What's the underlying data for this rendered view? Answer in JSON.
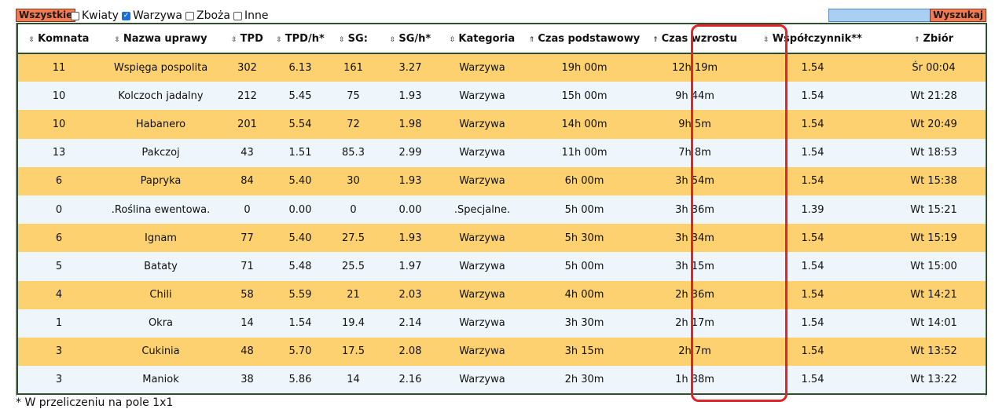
{
  "toolbar": {
    "all_label": "Wszystkie",
    "filters": [
      {
        "label": "Kwiaty",
        "checked": false
      },
      {
        "label": "Warzywa",
        "checked": true
      },
      {
        "label": "Zboża",
        "checked": false
      },
      {
        "label": "Inne",
        "checked": false
      }
    ],
    "search_value": "",
    "search_label": "Wyszukaj"
  },
  "table": {
    "columns": [
      {
        "label": "Komnata",
        "sort_icon": "⇳"
      },
      {
        "label": "Nazwa uprawy",
        "sort_icon": "⇳"
      },
      {
        "label": "TPD",
        "sort_icon": "⇳"
      },
      {
        "label": "TPD/h*",
        "sort_icon": "⇳"
      },
      {
        "label": "SG:",
        "sort_icon": "⇳"
      },
      {
        "label": "SG/h*",
        "sort_icon": "⇳"
      },
      {
        "label": "Kategoria",
        "sort_icon": "⇳"
      },
      {
        "label": "Czas podstawowy",
        "sort_icon": "⇑"
      },
      {
        "label": "Czas wzrostu",
        "sort_icon": "⇑"
      },
      {
        "label": "Współczynnik**",
        "sort_icon": "⇳"
      },
      {
        "label": "Zbiór",
        "sort_icon": "⇑"
      }
    ],
    "rows": [
      [
        "11",
        "Wspięga pospolita",
        "302",
        "6.13",
        "161",
        "3.27",
        "Warzywa",
        "19h 00m",
        "12h 19m",
        "1.54",
        "Śr 00:04"
      ],
      [
        "10",
        "Kolczoch jadalny",
        "212",
        "5.45",
        "75",
        "1.93",
        "Warzywa",
        "15h 00m",
        "9h 44m",
        "1.54",
        "Wt 21:28"
      ],
      [
        "10",
        "Habanero",
        "201",
        "5.54",
        "72",
        "1.98",
        "Warzywa",
        "14h 00m",
        "9h 5m",
        "1.54",
        "Wt 20:49"
      ],
      [
        "13",
        "Pakczoj",
        "43",
        "1.51",
        "85.3",
        "2.99",
        "Warzywa",
        "11h 00m",
        "7h 8m",
        "1.54",
        "Wt 18:53"
      ],
      [
        "6",
        "Papryka",
        "84",
        "5.40",
        "30",
        "1.93",
        "Warzywa",
        "6h 00m",
        "3h 54m",
        "1.54",
        "Wt 15:38"
      ],
      [
        "0",
        ".Roślina ewentowa.",
        "0",
        "0.00",
        "0",
        "0.00",
        ".Specjalne.",
        "5h 00m",
        "3h 36m",
        "1.39",
        "Wt 15:21"
      ],
      [
        "6",
        "Ignam",
        "77",
        "5.40",
        "27.5",
        "1.93",
        "Warzywa",
        "5h 30m",
        "3h 34m",
        "1.54",
        "Wt 15:19"
      ],
      [
        "5",
        "Bataty",
        "71",
        "5.48",
        "25.5",
        "1.97",
        "Warzywa",
        "5h 00m",
        "3h 15m",
        "1.54",
        "Wt 15:00"
      ],
      [
        "4",
        "Chili",
        "58",
        "5.59",
        "21",
        "2.03",
        "Warzywa",
        "4h 00m",
        "2h 36m",
        "1.54",
        "Wt 14:21"
      ],
      [
        "1",
        "Okra",
        "14",
        "1.54",
        "19.4",
        "2.14",
        "Warzywa",
        "3h 30m",
        "2h 17m",
        "1.54",
        "Wt 14:01"
      ],
      [
        "3",
        "Cukinia",
        "48",
        "5.70",
        "17.5",
        "2.08",
        "Warzywa",
        "3h 15m",
        "2h 7m",
        "1.54",
        "Wt 13:52"
      ],
      [
        "3",
        "Maniok",
        "38",
        "5.86",
        "14",
        "2.16",
        "Warzywa",
        "2h 30m",
        "1h 38m",
        "1.54",
        "Wt 13:22"
      ]
    ]
  },
  "highlight": {
    "column": "Czas wzrostu",
    "color": "#e0262b"
  },
  "colors": {
    "row_odd": "#fdd16f",
    "row_even": "#eef6fb",
    "button": "#f47a51"
  },
  "footnote": "* W przeliczeniu na pole 1x1"
}
